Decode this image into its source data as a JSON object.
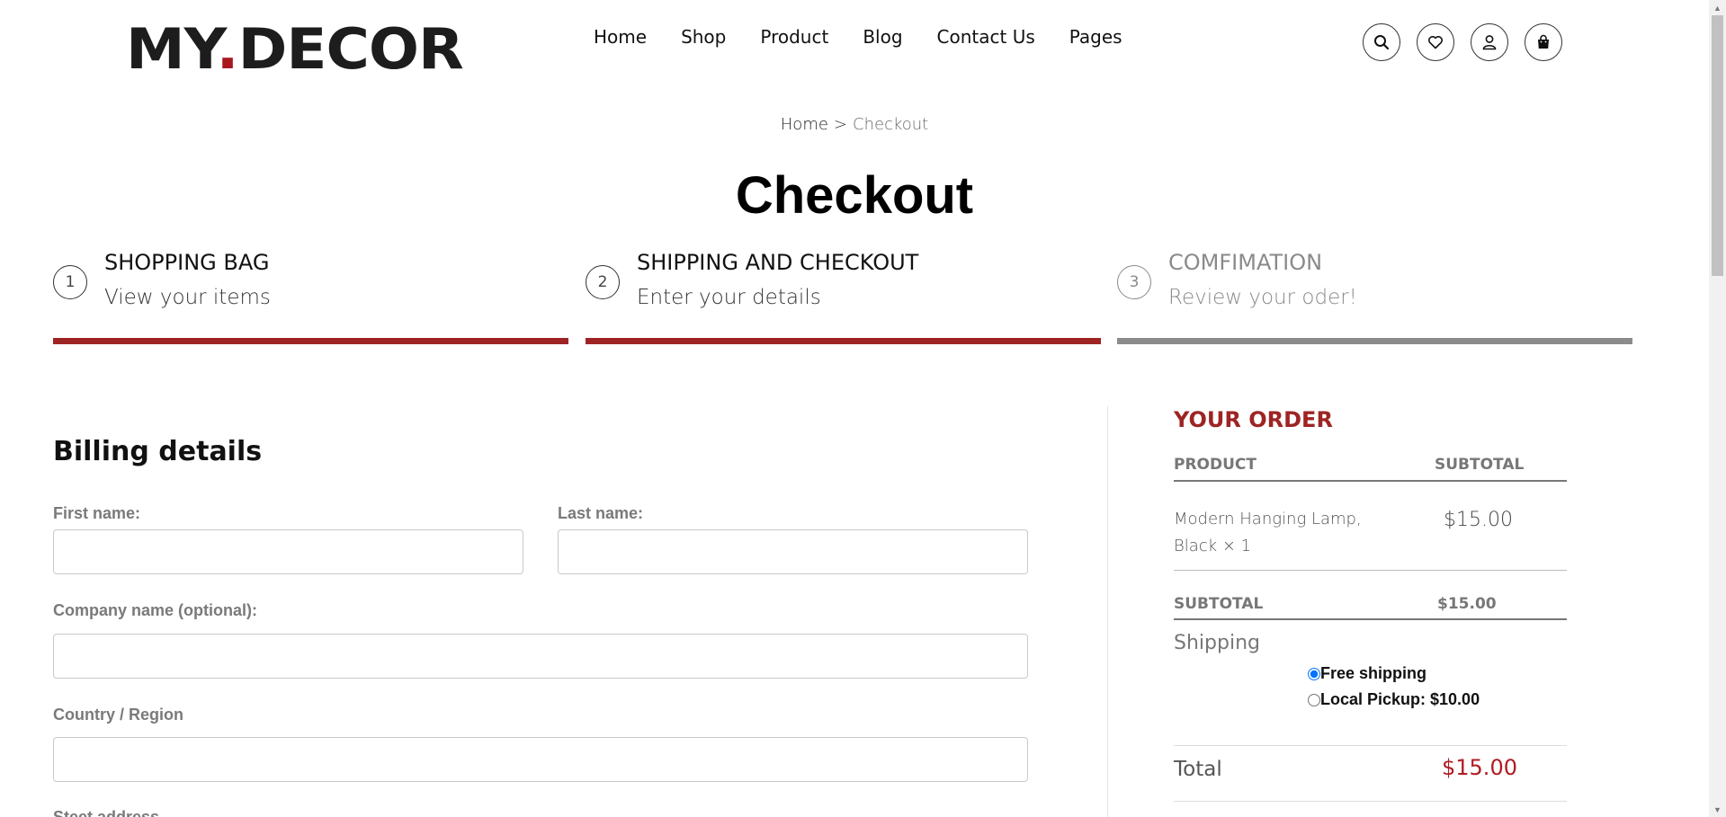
{
  "header": {
    "logo_text_a": "MY",
    "logo_text_dot": ".",
    "logo_text_b": "DECOR",
    "nav": [
      "Home",
      "Shop",
      "Product",
      "Blog",
      "Contact Us",
      "Pages"
    ],
    "icons": [
      "search-icon",
      "heart-icon",
      "user-icon",
      "bag-icon"
    ]
  },
  "breadcrumb": {
    "home": "Home",
    "separator": ">",
    "current": "Checkout"
  },
  "page_title": "Checkout",
  "steps": [
    {
      "num": "1",
      "title": "SHOPPING BAG",
      "subtitle": "View your items",
      "active": true
    },
    {
      "num": "2",
      "title": "SHIPPING AND CHECKOUT",
      "subtitle": "Enter your details",
      "active": true
    },
    {
      "num": "3",
      "title": "COMFIMATION",
      "subtitle": "Review your oder!",
      "active": false
    }
  ],
  "billing": {
    "title": "Billing details",
    "first_name_label": "First name:",
    "last_name_label": "Last name:",
    "company_label": "Company name (optional):",
    "country_label": "Country / Region",
    "street_label": "Steet address"
  },
  "order": {
    "title": "YOUR ORDER",
    "col_product": "PRODUCT",
    "col_subtotal": "SUBTOTAL",
    "items": [
      {
        "name": "Modern Hanging Lamp, Black × 1",
        "price": "$15.00"
      }
    ],
    "subtotal_label": "SUBTOTAL",
    "subtotal_value": "$15.00",
    "shipping_label": "Shipping",
    "shipping_options": [
      {
        "label": "Free shipping",
        "selected": true
      },
      {
        "label": "Local Pickup: $10.00",
        "selected": false
      }
    ],
    "total_label": "Total",
    "total_value": "$15.00"
  },
  "colors": {
    "accent": "#9e2424",
    "inactive": "#8b8b8b",
    "total": "#b01c22"
  }
}
